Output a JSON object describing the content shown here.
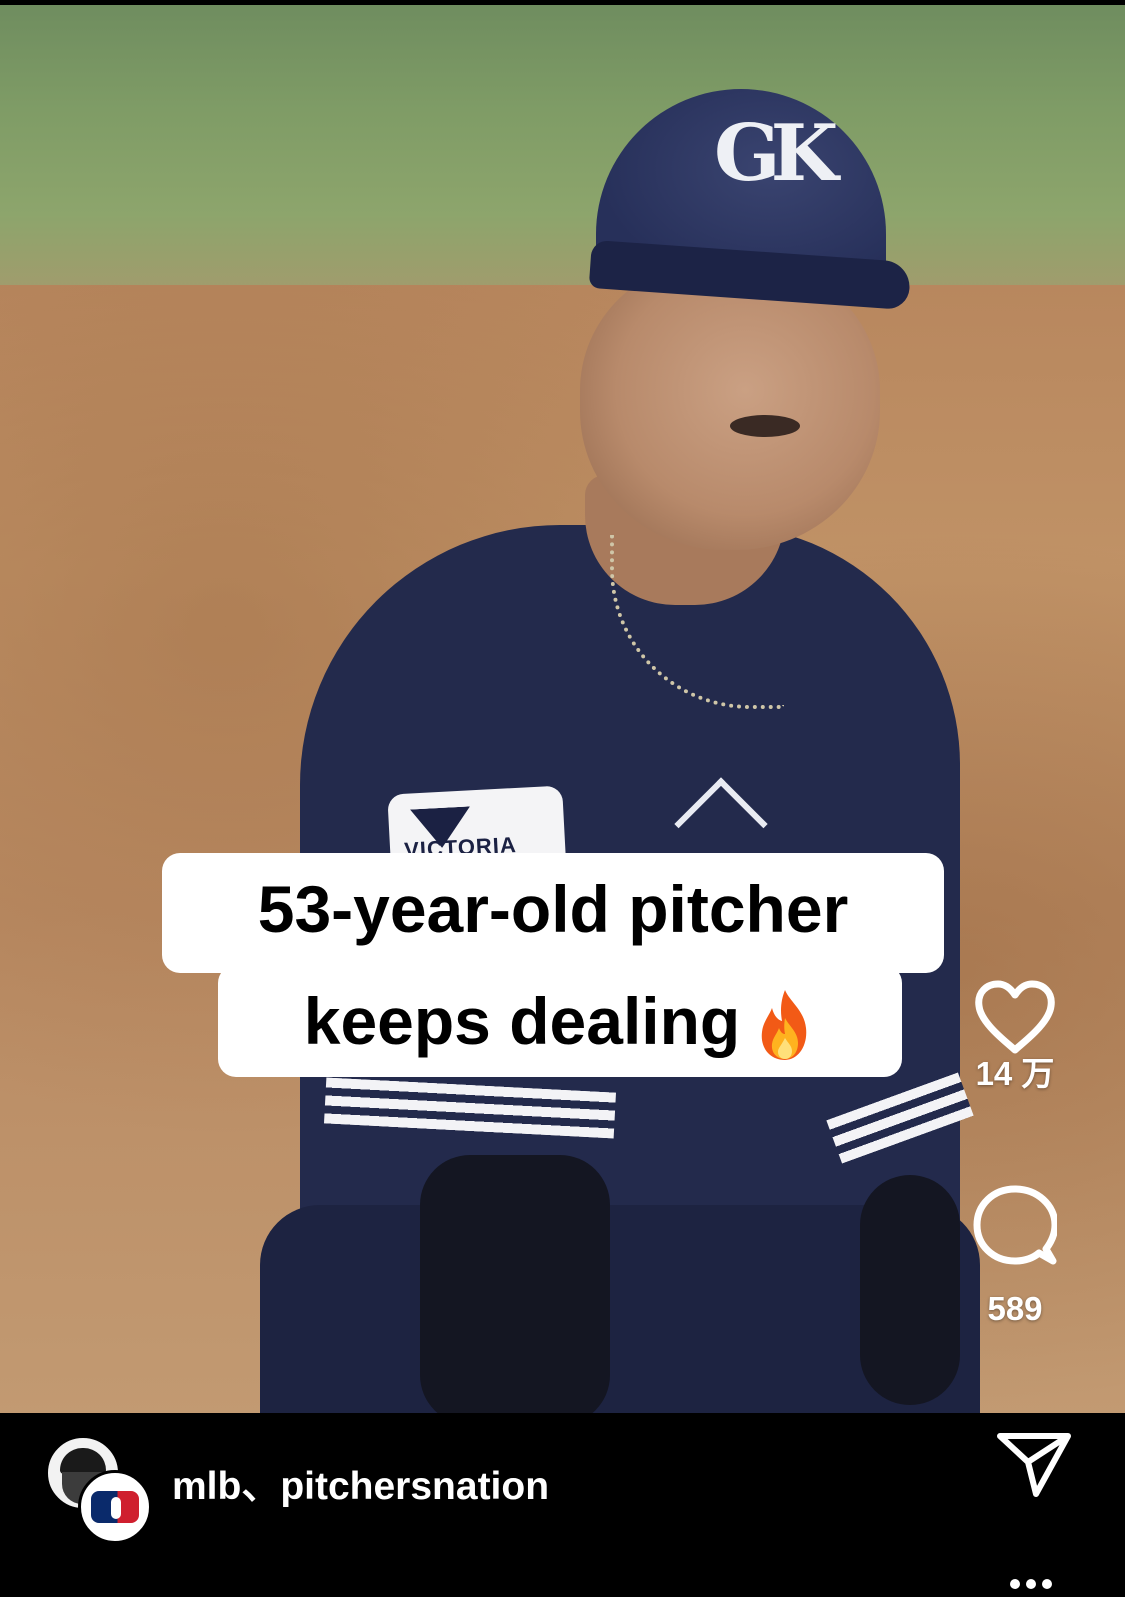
{
  "video": {
    "caption_line1": "53-year-old pitcher",
    "caption_line2": "keeps dealing",
    "caption_emoji": "fire-icon",
    "cap_logo": "GK",
    "patch_text": "VICTORIA"
  },
  "actions": {
    "like_count": "14 万",
    "comment_count": "589",
    "like_icon": "heart-icon",
    "comment_icon": "comment-bubble-icon",
    "share_icon": "paper-plane-icon",
    "more_icon": "ellipsis-icon"
  },
  "author": {
    "names": "mlb、pitchersnation",
    "avatar_primary": "pitchersnation-avatar",
    "avatar_secondary": "mlb-logo-avatar"
  },
  "colors": {
    "caption_bg": "#ffffff",
    "caption_text": "#000000",
    "icon": "#ffffff",
    "bar_bg": "#000000"
  }
}
